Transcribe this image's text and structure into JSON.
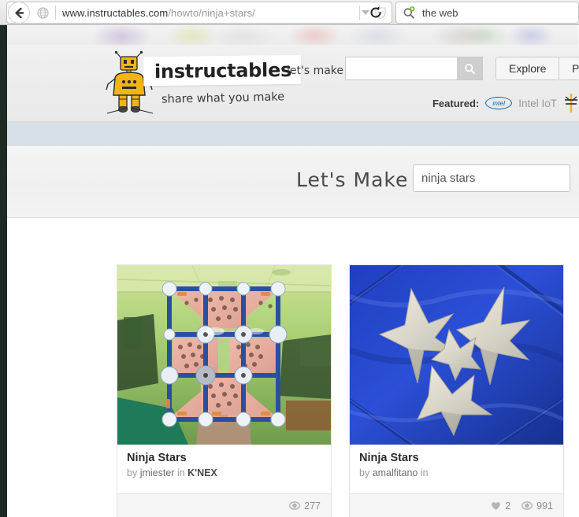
{
  "browser": {
    "back_icon": "back-arrow-icon",
    "site_icon": "globe-icon",
    "url_domain": "www.instructables.com",
    "url_path": "/howto/ninja+stars/",
    "dropdown_icon": "caret-down-icon",
    "reader_icon": "shield-icon",
    "reload_icon": "reload-icon",
    "search_engine_icon": "search-add-icon",
    "search_value": "the web"
  },
  "site_header": {
    "logo_text": "instructables",
    "robot_icon": "robot-mascot-icon",
    "tagline": "share what you make",
    "search_label": "let's make",
    "search_value": "",
    "search_placeholder": "",
    "search_button_icon": "search-icon",
    "buttons": [
      {
        "id": "explore",
        "label": "Explore"
      },
      {
        "id": "publish",
        "label": "Pub"
      }
    ],
    "featured_label": "Featured:",
    "featured_items": [
      {
        "logo_icon": "intel-logo-icon",
        "logo_text": "intel",
        "label": "Intel IoT"
      },
      {
        "logo_icon": "autodesk-icon",
        "logo_text": "",
        "label": ""
      }
    ]
  },
  "hero": {
    "title": "Let's Make",
    "query_value": "ninja stars",
    "query_placeholder": ""
  },
  "results": {
    "cards": [
      {
        "title": "Ninja Stars",
        "by_prefix": "by",
        "author": "jmiester",
        "in_prefix": "in",
        "channel": "K'NEX",
        "image_alt": "knex-ninja-star-photo",
        "stats": [
          {
            "icon": "eye-icon",
            "value": "277"
          }
        ]
      },
      {
        "title": "Ninja Stars",
        "by_prefix": "by",
        "author": "amalfitano",
        "in_prefix": "in",
        "channel": "",
        "image_alt": "metal-ninja-stars-on-blue-fabric-photo",
        "stats": [
          {
            "icon": "heart-icon",
            "value": "2"
          },
          {
            "icon": "eye-icon",
            "value": "991"
          }
        ]
      }
    ]
  },
  "colors": {
    "band": "#d7e0e7",
    "header_bg": "#eeeeee",
    "intel_blue": "#0068b5",
    "robot_yellow": "#f2b417",
    "card_border": "#e3e3e3",
    "muted_text": "#9b9b9b"
  }
}
